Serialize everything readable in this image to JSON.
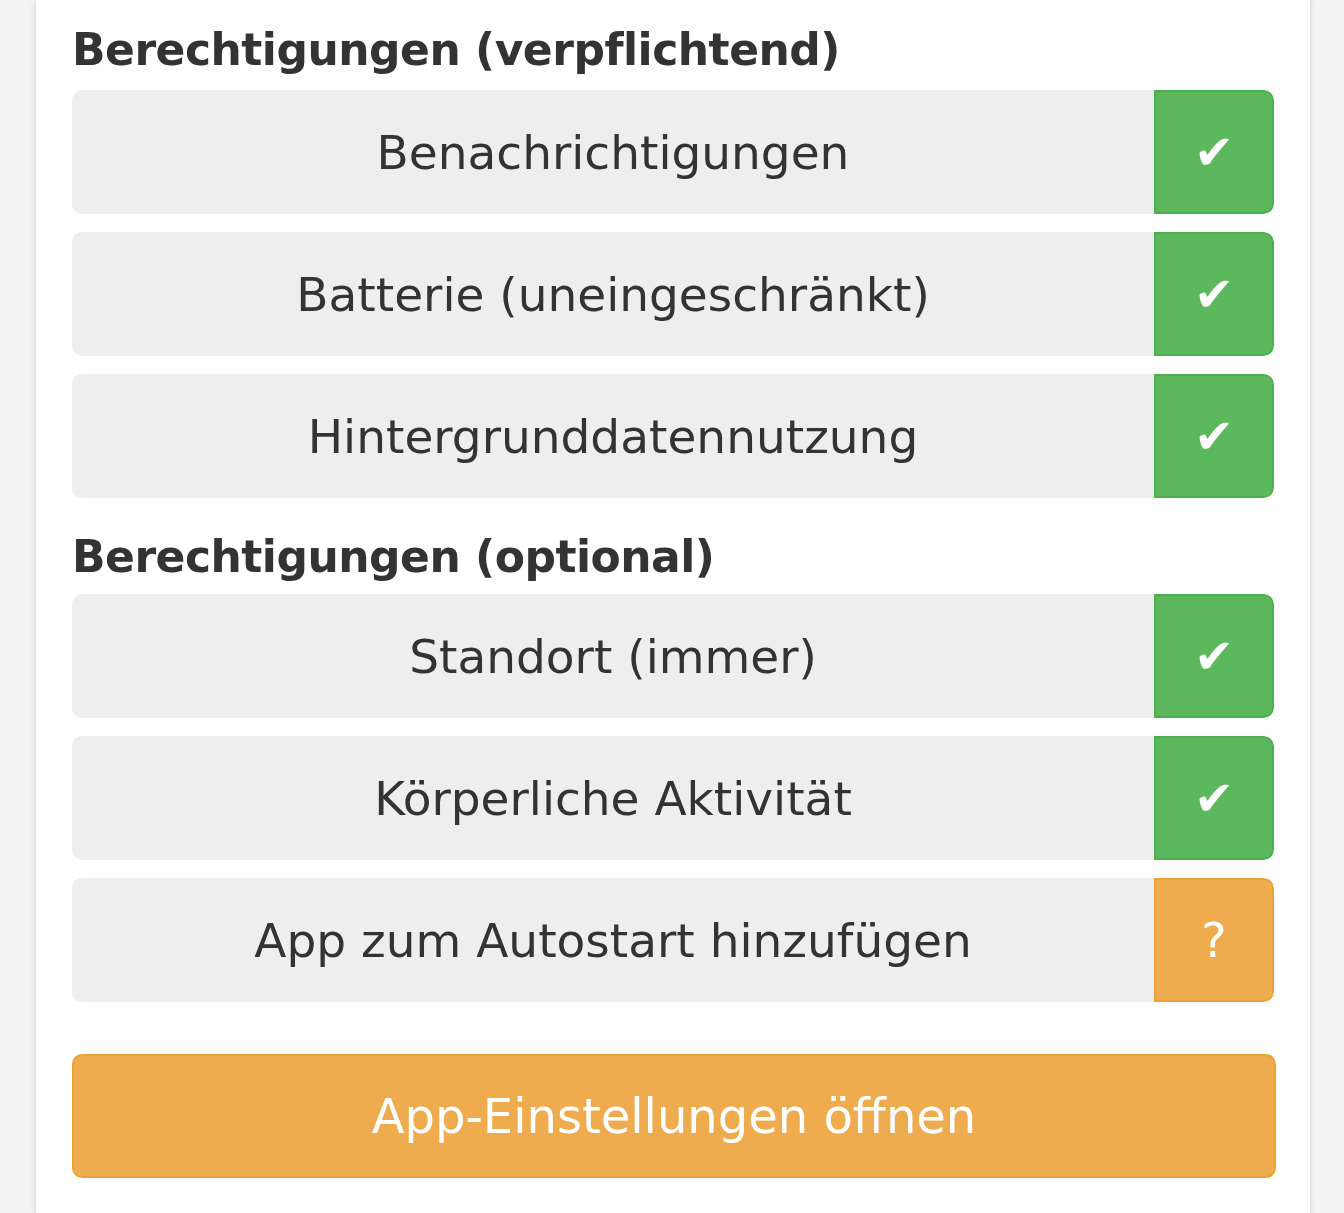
{
  "sections": [
    {
      "title": "Berechtigungen (verpflichtend)",
      "items": [
        {
          "label": "Benachrichtigungen",
          "granted": true,
          "mark": "✔"
        },
        {
          "label": "Batterie (uneingeschränkt)",
          "granted": true,
          "mark": "✔"
        },
        {
          "label": "Hintergrunddatennutzung",
          "granted": true,
          "mark": "✔"
        }
      ]
    },
    {
      "title": "Berechtigungen (optional)",
      "items": [
        {
          "label": "Standort (immer)",
          "granted": true,
          "mark": "✔"
        },
        {
          "label": "Körperliche Aktivität",
          "granted": true,
          "mark": "✔"
        },
        {
          "label": "App zum Autostart hinzufügen",
          "granted": false,
          "mark": "?"
        }
      ]
    }
  ],
  "button": {
    "label": "App-Einstellungen öffnen"
  }
}
